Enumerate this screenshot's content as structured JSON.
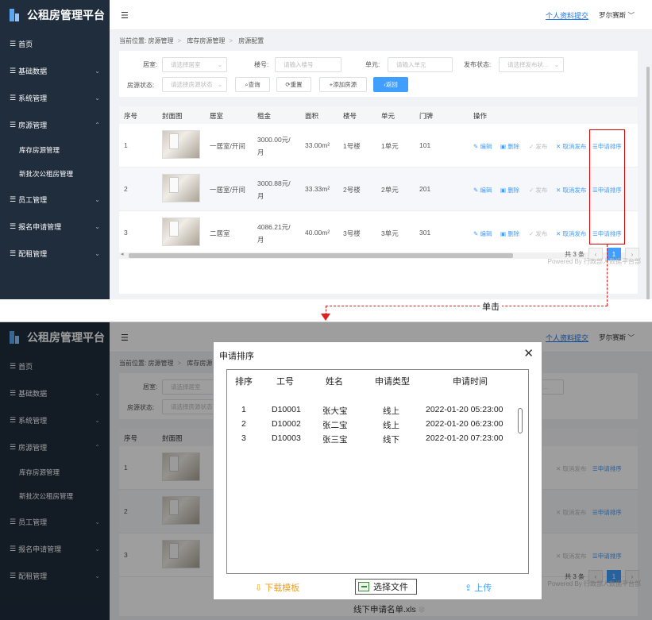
{
  "app": {
    "title": "公租房管理平台",
    "profile_link": "个人资料提交",
    "user_name": "罗尔赛斯 ﹀"
  },
  "sidebar": {
    "items": [
      {
        "label": "首页",
        "chev": ""
      },
      {
        "label": "基础数据",
        "chev": "⌄"
      },
      {
        "label": "系统管理",
        "chev": "⌄"
      },
      {
        "label": "房源管理",
        "chev": "⌃"
      }
    ],
    "sub_items": [
      {
        "label": "库存房源管理"
      },
      {
        "label": "新批次公租房管理"
      }
    ],
    "items_after": [
      {
        "label": "员工管理",
        "chev": "⌄"
      },
      {
        "label": "报名申请管理",
        "chev": "⌄"
      },
      {
        "label": "配租管理",
        "chev": "⌄"
      }
    ]
  },
  "breadcrumb": {
    "prefix": "当前位置:",
    "items": [
      "房源管理",
      "库存房源管理",
      "房源配置"
    ]
  },
  "filters": {
    "room_label": "居室:",
    "room_placeholder": "请选择居室",
    "building_label": "楼号:",
    "building_placeholder": "请输入楼号",
    "unit_label": "单元:",
    "unit_placeholder": "请输入单元",
    "publish_label": "发布状态:",
    "publish_placeholder": "请选择发布状...",
    "status_label": "房源状态:",
    "status_placeholder": "请选择房源状态",
    "query_btn": "查询",
    "reset_btn": "重置",
    "add_btn": "添加房源",
    "back_btn": "返回"
  },
  "table": {
    "headers": [
      "序号",
      "封面图",
      "居室",
      "租金",
      "面积",
      "楼号",
      "单元",
      "门牌",
      "操作"
    ],
    "rows": [
      {
        "no": "1",
        "room": "一居室/开间",
        "rent1": "3000.00元/",
        "rent2": "月",
        "area": "33.00m²",
        "building": "1号楼",
        "unit": "1单元",
        "door": "101"
      },
      {
        "no": "2",
        "room": "一居室/开间",
        "rent1": "3000.88元/",
        "rent2": "月",
        "area": "33.33m²",
        "building": "2号楼",
        "unit": "2单元",
        "door": "201"
      },
      {
        "no": "3",
        "room": "二居室",
        "rent1": "4086.21元/",
        "rent2": "月",
        "area": "40.00m²",
        "building": "3号楼",
        "unit": "3单元",
        "door": "301"
      }
    ],
    "actions": {
      "edit": "编辑",
      "delete": "删除",
      "publish": "发布",
      "unpublish": "取消发布",
      "sort": "申请排序"
    }
  },
  "pager": {
    "total": "共 3 条",
    "page": "1"
  },
  "powered": "Powered By 行政部人数据平台部",
  "annotation": {
    "click": "单击"
  },
  "dialog": {
    "title": "申请排序",
    "headers": [
      "排序",
      "工号",
      "姓名",
      "申请类型",
      "申请时间"
    ],
    "rows": [
      {
        "rank": "1",
        "id": "D10001",
        "name": "张大宝",
        "type": "线上",
        "time": "2022-01-20 05:23:00"
      },
      {
        "rank": "2",
        "id": "D10002",
        "name": "张二宝",
        "type": "线上",
        "time": "2022-01-20 06:23:00"
      },
      {
        "rank": "3",
        "id": "D10003",
        "name": "张三宝",
        "type": "线下",
        "time": "2022-01-20 07:23:00"
      }
    ],
    "download": "下载模板",
    "choose_file": "选择文件",
    "upload": "上传",
    "file_name": "线下申请名单.xls"
  }
}
